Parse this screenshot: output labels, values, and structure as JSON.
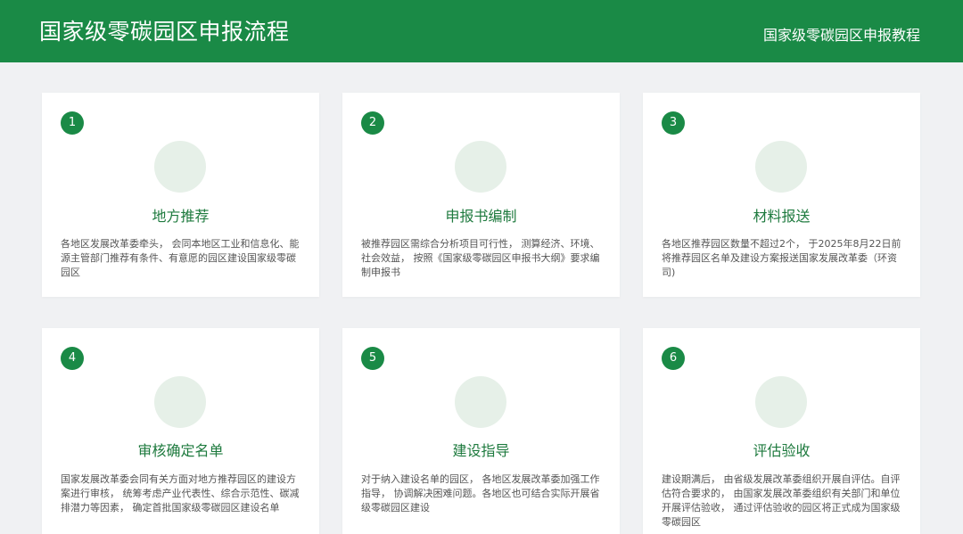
{
  "header": {
    "title": "国家级零碳园区申报流程",
    "subtitle": "国家级零碳园区申报教程"
  },
  "colors": {
    "brand_green": "#1a8a46",
    "title_green": "#1e7a3e",
    "icon_placeholder": "#e6f0e8",
    "background": "#f0f1f3"
  },
  "steps": [
    {
      "number": "1",
      "title": "地方推荐",
      "description": "各地区发展改革委牵头， 会同本地区工业和信息化、能源主管部门推荐有条件、有意愿的园区建设国家级零碳园区"
    },
    {
      "number": "2",
      "title": "申报书编制",
      "description": "被推荐园区需综合分析项目可行性， 测算经济、环境、社会效益， 按照《国家级零碳园区申报书大纲》要求编制申报书"
    },
    {
      "number": "3",
      "title": "材料报送",
      "description": "各地区推荐园区数量不超过2个， 于2025年8月22日前将推荐园区名单及建设方案报送国家发展改革委（环资司)"
    },
    {
      "number": "4",
      "title": "审核确定名单",
      "description": "国家发展改革委会同有关方面对地方推荐园区的建设方案进行审核， 统筹考虑产业代表性、综合示范性、碳减排潜力等因素， 确定首批国家级零碳园区建设名单"
    },
    {
      "number": "5",
      "title": "建设指导",
      "description": "对于纳入建设名单的园区， 各地区发展改革委加强工作指导， 协调解决困难问题。各地区也可结合实际开展省级零碳园区建设"
    },
    {
      "number": "6",
      "title": "评估验收",
      "description": "建设期满后， 由省级发展改革委组织开展自评估。自评估符合要求的， 由国家发展改革委组织有关部门和单位开展评估验收， 通过评估验收的园区将正式成为国家级零碳园区"
    }
  ]
}
